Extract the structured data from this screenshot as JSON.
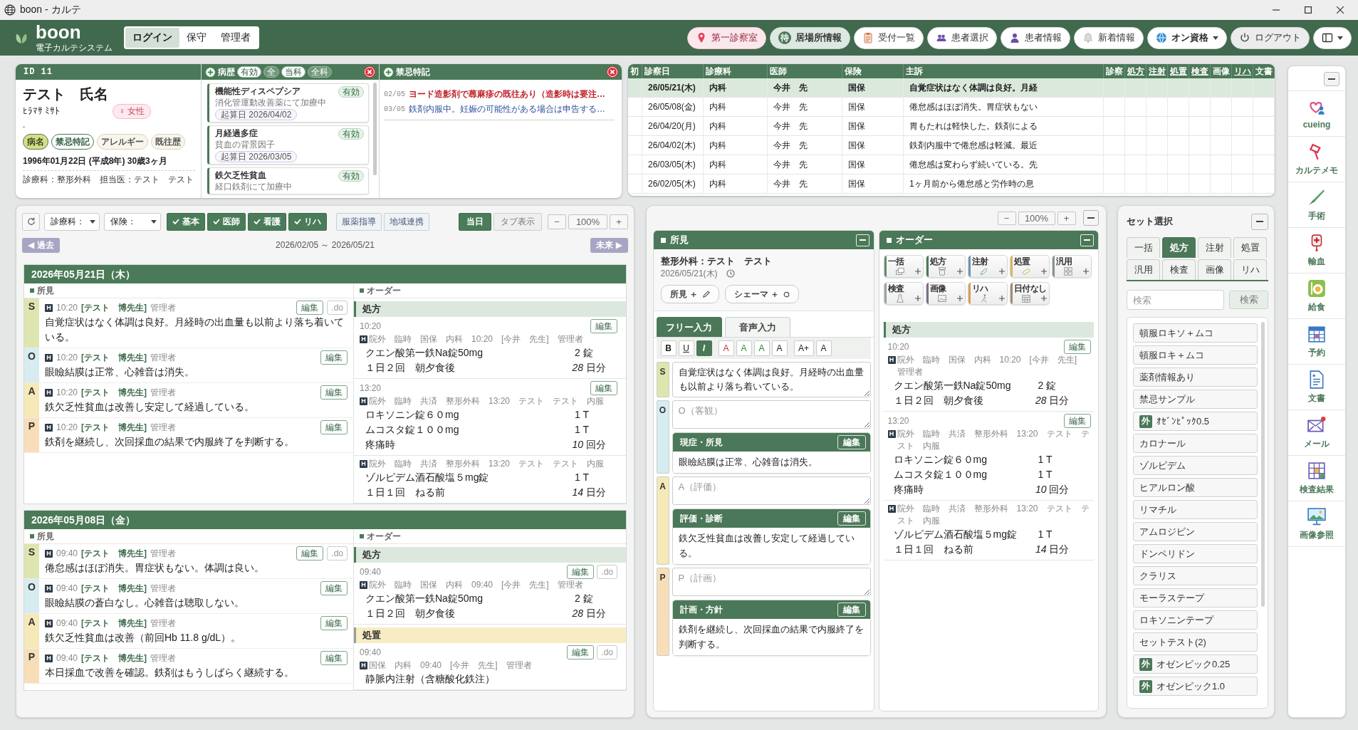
{
  "window": {
    "title": "boon - カルテ"
  },
  "header": {
    "logo": "boon",
    "subtitle": "電子カルテシステム",
    "modes": [
      {
        "label": "ログイン",
        "selected": true
      },
      {
        "label": "保守",
        "selected": false
      },
      {
        "label": "管理者",
        "selected": false
      }
    ],
    "actions": [
      {
        "label": "第一診察室",
        "kind": "room"
      },
      {
        "label": "居場所情報",
        "kind": "status",
        "badge": "待"
      },
      {
        "label": "受付一覧",
        "kind": "plain"
      },
      {
        "label": "患者選択",
        "kind": "plain"
      },
      {
        "label": "患者情報",
        "kind": "plain"
      },
      {
        "label": "新着情報",
        "kind": "plain"
      },
      {
        "label": "オン資格",
        "kind": "menu"
      },
      {
        "label": "ログアウト",
        "kind": "muted"
      },
      {
        "kind": "menu"
      }
    ]
  },
  "patient": {
    "id": "ID 11",
    "name": "テスト　氏名",
    "kana": "ﾋﾗﾏｻ ﾐｻﾄ",
    "sex": "♀ 女性",
    "note": ".",
    "tags": [
      {
        "label": "病名",
        "selected": true,
        "has_entries": true
      },
      {
        "label": "禁忌特記",
        "selected": false,
        "has_entries": true
      },
      {
        "label": "アレルギー",
        "selected": false,
        "has_entries": false
      },
      {
        "label": "既往歴",
        "selected": false,
        "has_entries": false
      }
    ],
    "birth": "1996年01月22日 (平成8年) 30歳3ヶ月",
    "department": "診療科：整形外科　担当医：テスト　テスト"
  },
  "history": {
    "title": "病歴",
    "filters": [
      {
        "label": "有効",
        "selected": true
      },
      {
        "label": "全",
        "selected": false
      },
      {
        "label": "当科",
        "selected": true
      },
      {
        "label": "全科",
        "selected": false
      }
    ],
    "items": [
      {
        "name": "機能性ディスペプシア",
        "status": "有効",
        "note": "消化管運動改善薬にて加療中",
        "onset": "起算日 2026/04/02"
      },
      {
        "name": "月経過多症",
        "status": "有効",
        "note": "貧血の背景因子",
        "onset": "起算日 2026/03/05"
      },
      {
        "name": "鉄欠乏性貧血",
        "status": "有効",
        "note": "経口鉄剤にて加療中"
      }
    ]
  },
  "contraindications": {
    "title": "禁忌特記",
    "items": [
      {
        "date": "02/05",
        "text": "ヨード造影剤で蕁麻疹の既往あり（造影時は要注…",
        "kind": "warning"
      },
      {
        "date": "03/05",
        "text": "鉄剤内服中。妊娠の可能性がある場合は申告する…",
        "kind": "note"
      }
    ]
  },
  "visits": {
    "columns": [
      {
        "label": "初",
        "link": false
      },
      {
        "label": "診察日",
        "link": false
      },
      {
        "label": "診療科",
        "link": false
      },
      {
        "label": "医師",
        "link": false
      },
      {
        "label": "保険",
        "link": false
      },
      {
        "label": "主訴",
        "link": false
      },
      {
        "label": "診察",
        "link": false
      },
      {
        "label": "処方",
        "link": true
      },
      {
        "label": "注射",
        "link": true
      },
      {
        "label": "処置",
        "link": true
      },
      {
        "label": "検査",
        "link": true
      },
      {
        "label": "画像",
        "link": false
      },
      {
        "label": "リハ",
        "link": true
      },
      {
        "label": "文書",
        "link": false
      }
    ],
    "rows": [
      {
        "selected": true,
        "date": "26/05/21(木)",
        "department": "内科",
        "doctor": "今井　先",
        "insurance": "国保",
        "complaint": "自覚症状はなく体調は良好。月経"
      },
      {
        "selected": false,
        "date": "26/05/08(金)",
        "department": "内科",
        "doctor": "今井　先",
        "insurance": "国保",
        "complaint": "倦怠感はほぼ消失。胃症状もない"
      },
      {
        "selected": false,
        "date": "26/04/20(月)",
        "department": "内科",
        "doctor": "今井　先",
        "insurance": "国保",
        "complaint": "胃もたれは軽快した。鉄剤による"
      },
      {
        "selected": false,
        "date": "26/04/02(木)",
        "department": "内科",
        "doctor": "今井　先",
        "insurance": "国保",
        "complaint": "鉄剤内服中で倦怠感は軽減。最近"
      },
      {
        "selected": false,
        "date": "26/03/05(木)",
        "department": "内科",
        "doctor": "今井　先",
        "insurance": "国保",
        "complaint": "倦怠感は変わらず続いている。先"
      },
      {
        "selected": false,
        "date": "26/02/05(木)",
        "department": "内科",
        "doctor": "今井　先",
        "insurance": "国保",
        "complaint": "1ヶ月前から倦怠感と労作時の息"
      }
    ]
  },
  "timeline": {
    "selects": [
      {
        "label": "診療科："
      },
      {
        "label": "保険："
      }
    ],
    "toggles": [
      {
        "label": "基本",
        "checked": true
      },
      {
        "label": "医師",
        "checked": true
      },
      {
        "label": "看護",
        "checked": true
      },
      {
        "label": "リハ",
        "checked": true
      },
      {
        "label": "服薬指導",
        "checked": false
      },
      {
        "label": "地域連携",
        "checked": false
      }
    ],
    "today_button": "当日",
    "tab_button": "タブ表示",
    "zoom": {
      "minus": "−",
      "value": "100%",
      "plus": "+"
    },
    "past_button": "◀ 過去",
    "range": "2026/02/05 ～ 2026/05/21",
    "future_button": "未来 ▶",
    "days": [
      {
        "date": "2026年05月21日（木）",
        "findings_label": "所見",
        "orders_label": "オーダー",
        "notes": [
          {
            "letter": "S",
            "color": "#dfe5ae",
            "badge": "H",
            "time": "10:20",
            "author": "[テスト　博先生]",
            "role": "管理者",
            "text": "自覚症状はなく体調は良好。月経時の出血量も以前より落ち着いている。",
            "buttons": [
              "編集",
              ".do"
            ]
          },
          {
            "letter": "O",
            "color": "#d6ecf0",
            "badge": "H",
            "time": "10:20",
            "author": "[テスト　博先生]",
            "role": "管理者",
            "text": "眼瞼結膜は正常、心雑音は消失。",
            "buttons": [
              "編集"
            ]
          },
          {
            "letter": "A",
            "color": "#f6e9b8",
            "badge": "H",
            "time": "10:20",
            "author": "[テスト　博先生]",
            "role": "管理者",
            "text": "鉄欠乏性貧血は改善し安定して経過している。",
            "buttons": [
              "編集"
            ]
          },
          {
            "letter": "P",
            "color": "#f8deb8",
            "badge": "H",
            "time": "10:20",
            "author": "[テスト　博先生]",
            "role": "管理者",
            "text": "鉄剤を継続し、次回採血の結果で内服終了を判断する。",
            "buttons": [
              "編集"
            ]
          }
        ],
        "order_groups": [
          {
            "category": "処方",
            "kind": "prescription",
            "entries": [
              {
                "time": "10:20",
                "buttons": [
                  "編集"
                ],
                "badge": "H",
                "meta": "院外　臨時　国保　内科　10:20　[今井　先生]　管理者",
                "drugs": [
                  {
                    "name": "クエン酸第一鉄Na錠50mg",
                    "qty": "2 錠"
                  }
                ],
                "usage": "１日２回　朝夕食後",
                "duration": "*28* 日分"
              },
              {
                "time": "13:20",
                "buttons": [
                  "編集"
                ],
                "badge": "H",
                "meta": "院外　臨時　共済　整形外科　13:20　テスト　テスト　内服",
                "drugs": [
                  {
                    "name": "ロキソニン錠６０mg",
                    "qty": "1 T"
                  },
                  {
                    "name": "ムコスタ錠１００mg",
                    "qty": "1 T"
                  }
                ],
                "usage": "疼痛時",
                "duration": "*10* 回分"
              },
              {
                "badge": "H",
                "meta": "院外　臨時　共済　整形外科　13:20　テスト　テスト　内服",
                "drugs": [
                  {
                    "name": "ゾルピデム酒石酸塩５mg錠",
                    "qty": "1 T"
                  }
                ],
                "usage": "１日１回　ねる前",
                "duration": "*14* 日分"
              }
            ]
          }
        ]
      },
      {
        "date": "2026年05月08日（金）",
        "findings_label": "所見",
        "orders_label": "オーダー",
        "notes": [
          {
            "letter": "S",
            "color": "#dfe5ae",
            "badge": "H",
            "time": "09:40",
            "author": "[テスト　博先生]",
            "role": "管理者",
            "text": "倦怠感はほぼ消失。胃症状もない。体調は良い。",
            "buttons": [
              "編集",
              ".do"
            ]
          },
          {
            "letter": "O",
            "color": "#d6ecf0",
            "badge": "H",
            "time": "09:40",
            "author": "[テスト　博先生]",
            "role": "管理者",
            "text": "眼瞼結膜の蒼白なし。心雑音は聴取しない。",
            "buttons": [
              "編集"
            ]
          },
          {
            "letter": "A",
            "color": "#f6e9b8",
            "badge": "H",
            "time": "09:40",
            "author": "[テスト　博先生]",
            "role": "管理者",
            "text": "鉄欠乏性貧血は改善（前回Hb 11.8 g/dL）。",
            "buttons": [
              "編集"
            ]
          },
          {
            "letter": "P",
            "color": "#f8deb8",
            "badge": "H",
            "time": "09:40",
            "author": "[テスト　博先生]",
            "role": "管理者",
            "text": "本日採血で改善を確認。鉄剤はもうしばらく継続する。",
            "buttons": [
              "編集"
            ]
          }
        ],
        "order_groups": [
          {
            "category": "処方",
            "kind": "prescription",
            "entries": [
              {
                "time": "09:40",
                "buttons": [
                  "編集",
                  ".do"
                ],
                "badge": "H",
                "meta": "院外　臨時　国保　内科　09:40　[今井　先生]　管理者",
                "drugs": [
                  {
                    "name": "クエン酸第一鉄Na錠50mg",
                    "qty": "2 錠"
                  }
                ],
                "usage": "１日２回　朝夕食後",
                "duration": "*28* 日分"
              }
            ]
          },
          {
            "category": "処置",
            "kind": "procedure",
            "entries": [
              {
                "time": "09:40",
                "buttons": [
                  "編集",
                  ".do"
                ],
                "badge": "H",
                "meta": "国保　内科　09:40　[今井　先生]　管理者",
                "drugs": [
                  {
                    "name": "静脈内注射（含糖酸化鉄注）"
                  }
                ]
              }
            ]
          }
        ]
      }
    ]
  },
  "editor": {
    "zoom": {
      "minus": "−",
      "value": "100%",
      "plus": "+"
    },
    "findings": {
      "title": "所見",
      "author": "整形外科：テスト　テスト",
      "date": "2026/05/21(木)",
      "actions": [
        {
          "label": "所見 ＋"
        },
        {
          "label": "シェーマ ＋"
        }
      ],
      "tabs": [
        {
          "label": "フリー入力",
          "selected": true
        },
        {
          "label": "音声入力",
          "selected": false
        }
      ],
      "format_buttons": [
        {
          "label": "B",
          "kind": "bold",
          "selected": false
        },
        {
          "label": "U",
          "kind": "underline",
          "selected": false
        },
        {
          "label": "I",
          "kind": "italic",
          "selected": true
        },
        {
          "label": "A",
          "kind": "color",
          "color": "#c0392b",
          "selected": false
        },
        {
          "label": "A",
          "kind": "color",
          "color": "#3b8a3e",
          "selected": false
        },
        {
          "label": "A",
          "kind": "color",
          "color": "#2f7d32",
          "selected": false
        },
        {
          "label": "A",
          "kind": "color",
          "color": "#222222",
          "selected": false
        },
        {
          "label": "A+",
          "kind": "size",
          "selected": false
        },
        {
          "label": "A",
          "kind": "reset",
          "selected": false
        }
      ],
      "rows": [
        {
          "letter": "S",
          "color": "#dfe5ae",
          "value": "自覚症状はなく体調は良好。月経時の出血量も以前より落ち着いている。"
        },
        {
          "letter": "O",
          "color": "#d6ecf0",
          "placeholder": "O（客観）",
          "record": {
            "title": "現症・所見",
            "button": "編集",
            "text": "眼瞼結膜は正常、心雑音は消失。"
          }
        },
        {
          "letter": "A",
          "color": "#f6e9b8",
          "placeholder": "A（評価）",
          "record": {
            "title": "評価・診断",
            "button": "編集",
            "text": "鉄欠乏性貧血は改善し安定して経過している。"
          }
        },
        {
          "letter": "P",
          "color": "#f8deb8",
          "placeholder": "P（計画）",
          "record": {
            "title": "計画・方針",
            "button": "編集",
            "text": "鉄剤を継続し、次回採血の結果で内服終了を判断する。"
          }
        }
      ]
    },
    "orders": {
      "title": "オーダー",
      "types": [
        {
          "label": "一括",
          "color": "#5d8f6b"
        },
        {
          "label": "処方",
          "color": "#4b7858"
        },
        {
          "label": "注射",
          "color": "#6f93ad"
        },
        {
          "label": "処置",
          "color": "#d8b45c"
        },
        {
          "label": "汎用",
          "color": "#8c9196"
        },
        {
          "label": "検査",
          "color": "#9ba1a5"
        },
        {
          "label": "画像",
          "color": "#7b6c8c"
        },
        {
          "label": "リハ",
          "color": "#dc9c5c"
        },
        {
          "label": "日付なし",
          "color": "#a38c72"
        }
      ],
      "groups": [
        {
          "category": "処方",
          "kind": "prescription",
          "entries": [
            {
              "time": "10:20",
              "buttons": [
                "編集"
              ],
              "badge": "H",
              "meta": "院外　臨時　国保　内科　10:20　[今井　先生]　管理者",
              "drugs": [
                {
                  "name": "クエン酸第一鉄Na錠50mg",
                  "qty": "2 錠"
                }
              ],
              "usage": "１日２回　朝夕食後",
              "duration": "*28* 日分"
            },
            {
              "time": "13:20",
              "buttons": [
                "編集"
              ],
              "badge": "H",
              "meta": "院外　臨時　共済　整形外科　13:20　テスト　テスト　内服",
              "drugs": [
                {
                  "name": "ロキソニン錠６０mg",
                  "qty": "1 T"
                },
                {
                  "name": "ムコスタ錠１００mg",
                  "qty": "1 T"
                }
              ],
              "usage": "疼痛時",
              "duration": "*10* 回分"
            },
            {
              "badge": "H",
              "meta": "院外　臨時　共済　整形外科　13:20　テスト　テスト　内服",
              "drugs": [
                {
                  "name": "ゾルピデム酒石酸塩５mg錠",
                  "qty": "1 T"
                }
              ],
              "usage": "１日１回　ねる前",
              "duration": "*14* 日分"
            }
          ]
        }
      ]
    }
  },
  "sets": {
    "title": "セット選択",
    "tabs": [
      {
        "label": "一括",
        "selected": false
      },
      {
        "label": "処方",
        "selected": true
      },
      {
        "label": "注射",
        "selected": false
      },
      {
        "label": "処置",
        "selected": false
      },
      {
        "label": "汎用",
        "selected": false
      },
      {
        "label": "検査",
        "selected": false
      },
      {
        "label": "画像",
        "selected": false
      },
      {
        "label": "リハ",
        "selected": false
      }
    ],
    "search": {
      "placeholder": "検索",
      "button": "検索"
    },
    "items": [
      {
        "label": "頓服ロキソ＋ムコ"
      },
      {
        "label": "頓服ロキ＋ムコ"
      },
      {
        "label": "薬剤情報あり"
      },
      {
        "label": "禁忌サンプル"
      },
      {
        "badge": "外",
        "label": "ｵｾﾞﾝﾋﾟｯｸ0.5"
      },
      {
        "label": "カロナール"
      },
      {
        "label": "ゾルピデム"
      },
      {
        "label": "ヒアルロン酸"
      },
      {
        "label": "リマチル"
      },
      {
        "label": "アムロジピン"
      },
      {
        "label": "ドンペリドン"
      },
      {
        "label": "クラリス"
      },
      {
        "label": "モーラステープ"
      },
      {
        "label": "ロキソニンテープ"
      },
      {
        "label": "セットテスト(2)"
      },
      {
        "badge": "外",
        "label": "オゼンピック0.25"
      },
      {
        "badge": "外",
        "label": "オゼンピック1.0"
      }
    ]
  },
  "tools": [
    {
      "label": "cueing"
    },
    {
      "label": "カルテメモ"
    },
    {
      "label": "手術"
    },
    {
      "label": "輸血"
    },
    {
      "label": "給食"
    },
    {
      "label": "予約"
    },
    {
      "label": "文書"
    },
    {
      "label": "メール"
    },
    {
      "label": "検査結果"
    },
    {
      "label": "画像参照"
    }
  ]
}
